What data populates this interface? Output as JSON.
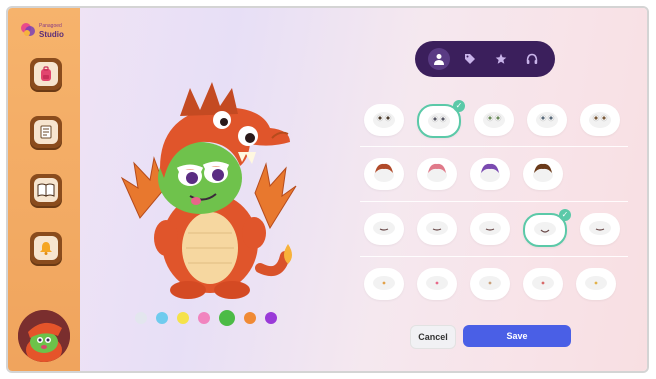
{
  "app": {
    "logo_small": "Panagoed",
    "logo_title": "Studio"
  },
  "sidebar": {
    "items": [
      {
        "name": "backpack",
        "icon": "backpack-icon"
      },
      {
        "name": "notes",
        "icon": "document-icon"
      },
      {
        "name": "book",
        "icon": "book-icon"
      },
      {
        "name": "notifications",
        "icon": "bell-icon"
      }
    ],
    "avatar": "dragon-avatar"
  },
  "colors": {
    "sidebar": "#f0a45d",
    "tabs_bg": "#3b1f5c",
    "selected_outline": "#5bc9a8",
    "save": "#4a5fe6"
  },
  "swatches": [
    "#e3e6ee",
    "#6fcbee",
    "#f5e24a",
    "#f184bf",
    "#4cbb46",
    "#f08a35",
    "#9a3ad8"
  ],
  "selected_swatch": 4,
  "tabs": [
    "person-icon",
    "tag-icon",
    "star-icon",
    "headphones-icon"
  ],
  "active_tab": 0,
  "grid": {
    "rows": [
      {
        "count": 5,
        "selected": 1,
        "variant": "eyes"
      },
      {
        "count": 4,
        "selected": -1,
        "variant": "hair"
      },
      {
        "count": 5,
        "selected": 3,
        "variant": "mouth"
      },
      {
        "count": 5,
        "selected": -1,
        "variant": "face"
      }
    ]
  },
  "actions": {
    "cancel": "Cancel",
    "save": "Save"
  }
}
